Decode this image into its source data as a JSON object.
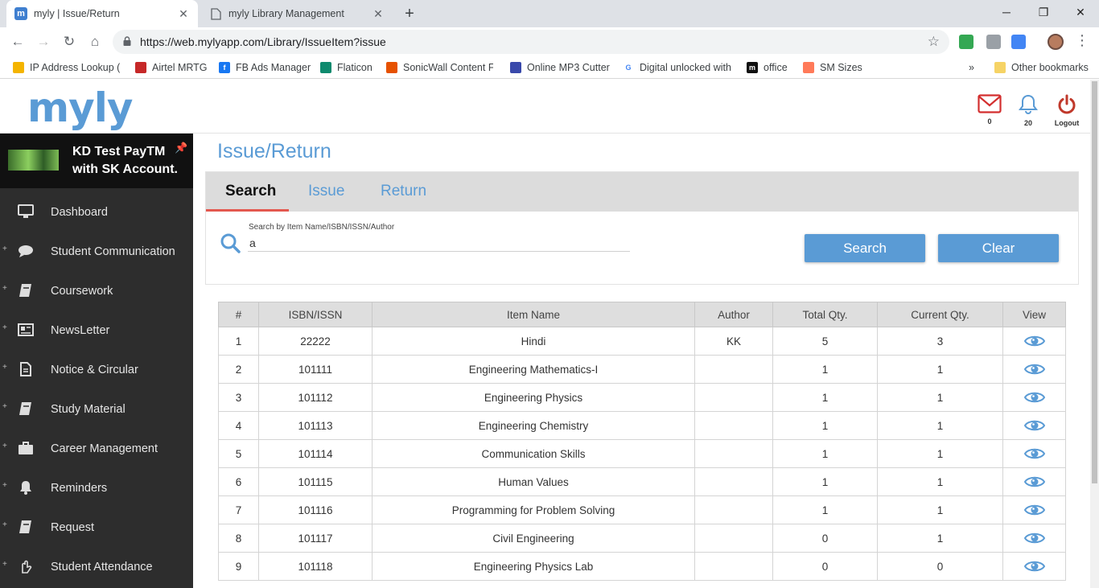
{
  "browser": {
    "tabs": [
      {
        "title": "myly | Issue/Return",
        "active": true,
        "favicon": "m"
      },
      {
        "title": "myly Library Management",
        "active": false,
        "favicon": "page"
      }
    ],
    "url": "https://web.mylyapp.com/Library/IssueItem?issue",
    "bookmarks": [
      "IP Address Lookup (IP",
      "Airtel MRTG",
      "FB Ads Manager",
      "Flaticon",
      "SonicWall Content Fil",
      "Online MP3 Cutter",
      "Digital unlocked with",
      "office",
      "SM Sizes"
    ],
    "bookmarks_overflow": "»",
    "other_bookmarks": "Other bookmarks"
  },
  "header": {
    "logo": "myly",
    "mail_count": "0",
    "notification_count": "20",
    "logout_label": "Logout"
  },
  "sidebar": {
    "school_name": "KD Test PayTM with SK Account.",
    "items": [
      {
        "label": "Dashboard",
        "icon": "monitor-icon",
        "expandable": false
      },
      {
        "label": "Student Communication",
        "icon": "chat-icon",
        "expandable": true
      },
      {
        "label": "Coursework",
        "icon": "book-icon",
        "expandable": true
      },
      {
        "label": "NewsLetter",
        "icon": "newspaper-icon",
        "expandable": true
      },
      {
        "label": "Notice & Circular",
        "icon": "document-icon",
        "expandable": true
      },
      {
        "label": "Study Material",
        "icon": "book-icon",
        "expandable": true
      },
      {
        "label": "Career Management",
        "icon": "briefcase-icon",
        "expandable": true
      },
      {
        "label": "Reminders",
        "icon": "bell-icon",
        "expandable": true
      },
      {
        "label": "Request",
        "icon": "book-icon",
        "expandable": true
      },
      {
        "label": "Student Attendance",
        "icon": "hand-icon",
        "expandable": true
      }
    ]
  },
  "main": {
    "title": "Issue/Return",
    "tabs": [
      "Search",
      "Issue",
      "Return"
    ],
    "search": {
      "label": "Search by Item Name/ISBN/ISSN/Author",
      "value": "a",
      "search_button": "Search",
      "clear_button": "Clear"
    },
    "table": {
      "columns": [
        "#",
        "ISBN/ISSN",
        "Item Name",
        "Author",
        "Total Qty.",
        "Current Qty.",
        "View"
      ],
      "rows": [
        [
          "1",
          "22222",
          "Hindi",
          "KK",
          "5",
          "3"
        ],
        [
          "2",
          "101111",
          "Engineering Mathematics-I",
          "",
          "1",
          "1"
        ],
        [
          "3",
          "101112",
          "Engineering Physics",
          "",
          "1",
          "1"
        ],
        [
          "4",
          "101113",
          "Engineering Chemistry",
          "",
          "1",
          "1"
        ],
        [
          "5",
          "101114",
          "Communication Skills",
          "",
          "1",
          "1"
        ],
        [
          "6",
          "101115",
          "Human Values",
          "",
          "1",
          "1"
        ],
        [
          "7",
          "101116",
          "Programming for Problem Solving",
          "",
          "1",
          "1"
        ],
        [
          "8",
          "101117",
          "Civil Engineering",
          "",
          "0",
          "1"
        ],
        [
          "9",
          "101118",
          "Engineering Physics Lab",
          "",
          "0",
          "0"
        ]
      ]
    }
  },
  "colors": {
    "accent": "#5a9bd5",
    "sidebar_bg": "#2d2d2d",
    "tab_underline": "#e3584f",
    "logout_red": "#c0392b"
  }
}
